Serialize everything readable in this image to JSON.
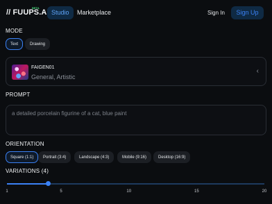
{
  "header": {
    "logo": "// FUUPS.AI",
    "beta": "BETA",
    "nav": [
      {
        "label": "Studio",
        "active": true
      },
      {
        "label": "Marketplace",
        "active": false
      }
    ],
    "signin": "Sign In",
    "signup": "Sign Up"
  },
  "mode": {
    "label": "MODE",
    "options": [
      {
        "label": "Text",
        "active": true
      },
      {
        "label": "Drawing",
        "active": false
      }
    ]
  },
  "model": {
    "name": "FAIGEN01",
    "tags": "General, Artistic",
    "chevron": "‹",
    "icon": "chevron-left-icon"
  },
  "prompt": {
    "label": "PROMPT",
    "placeholder": "a detailed porcelain figurine of a cat, blue paint"
  },
  "orientation": {
    "label": "ORIENTATION",
    "options": [
      {
        "label": "Square (1:1)",
        "active": true
      },
      {
        "label": "Portrait (3:4)",
        "active": false
      },
      {
        "label": "Landscape (4:3)",
        "active": false
      },
      {
        "label": "Mobile (9:16)",
        "active": false
      },
      {
        "label": "Desktop (16:9)",
        "active": false
      }
    ]
  },
  "variations": {
    "label": "VARIATIONS (4)",
    "value": 4,
    "min": 1,
    "max": 20,
    "ticks": [
      "1",
      "5",
      "10",
      "15",
      "20"
    ]
  },
  "colors": {
    "accent": "#3b82f6",
    "beta": "#4ade80",
    "background": "#0b0d10"
  }
}
